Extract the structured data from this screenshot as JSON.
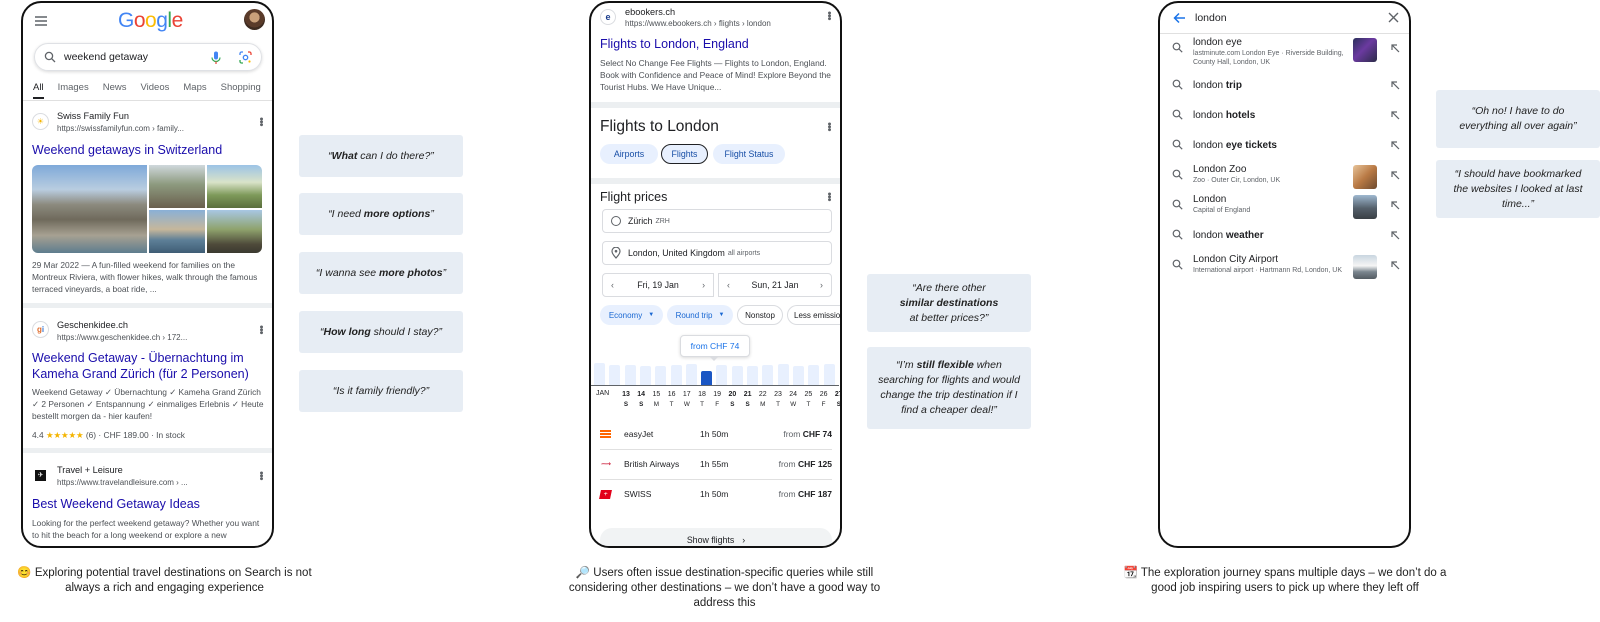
{
  "phone1": {
    "logo": "Google",
    "search_query": "weekend getaway",
    "tabs": [
      "All",
      "Images",
      "News",
      "Videos",
      "Maps",
      "Shopping"
    ],
    "results": [
      {
        "site": "Swiss Family Fun",
        "url": "https://swissfamilyfun.com › family...",
        "title": "Weekend getaways in Switzerland",
        "date": "29 Mar 2022",
        "snippet": "29 Mar 2022 — A fun-filled weekend for families on the Montreux Riviera, with flower hikes, walk through the famous terraced vineyards, a boat ride, ..."
      },
      {
        "site": "Geschenkidee.ch",
        "url": "https://www.geschenkidee.ch › 172...",
        "title": "Weekend Getaway - Übernachtung im Kameha Grand Zürich (für 2 Personen)",
        "snippet": "Weekend Getaway ✓ Übernachtung ✓ Kameha Grand Zürich ✓ 2 Personen ✓ Entspannung ✓ einmaliges Erlebnis ✓ Heute bestellt morgen da - hier kaufen!",
        "rating": "4.4",
        "stars": "★★★★★",
        "rating_tail": "(6) · CHF 189.00 · In stock"
      },
      {
        "site": "Travel + Leisure",
        "url": "https://www.travelandleisure.com › ...",
        "title": "Best Weekend Getaway Ideas",
        "snippet": "Looking for the perfect weekend getaway? Whether you want to hit the beach for a long weekend or explore a new"
      }
    ]
  },
  "quotes1": [
    {
      "pre": "“",
      "bold": "What",
      "post": " can I do there?”"
    },
    {
      "pre": "“I need ",
      "bold": "more options",
      "post": "”"
    },
    {
      "pre": "“I wanna see ",
      "bold": "more photos",
      "post": "”"
    },
    {
      "pre": "“",
      "bold": "How long",
      "post": " should I stay?”"
    },
    {
      "pre": "“Is it family friendly?”",
      "bold": "",
      "post": ""
    }
  ],
  "caption1": "😊 Exploring potential travel destinations on Search is not always a rich and engaging experience",
  "phone2": {
    "site": "ebookers.ch",
    "url": "https://www.ebookers.ch › flights › london",
    "result_title": "Flights to London, England",
    "result_snippet": "Select No Change Fee Flights — Flights to London, England. Book with Confidence and Peace of Mind! Explore Beyond the Tourist Hubs. We Have Unique...",
    "heading": "Flights to London",
    "chips": [
      "Airports",
      "Flights",
      "Flight Status"
    ],
    "prices_heading": "Flight prices",
    "origin": "Zürich",
    "origin_code": "ZRH",
    "destination": "London, United Kingdom",
    "destination_note": "all airports",
    "date_from": "Fri, 19 Jan",
    "date_to": "Sun, 21 Jan",
    "filters": [
      "Economy",
      "Round trip",
      "Nonstop",
      "Less emissio"
    ],
    "tooltip": "from CHF 74",
    "month": "JAN",
    "days": [
      "13",
      "14",
      "15",
      "16",
      "17",
      "18",
      "19",
      "20",
      "21",
      "22",
      "23",
      "24",
      "25",
      "26",
      "27"
    ],
    "weekdays": [
      "S",
      "S",
      "M",
      "T",
      "W",
      "T",
      "F",
      "S",
      "S",
      "M",
      "T",
      "W",
      "T",
      "F",
      "S"
    ],
    "bold_days": [
      "13",
      "14",
      "20",
      "21",
      "27"
    ],
    "airlines": [
      {
        "name": "easyJet",
        "duration": "1h 50m",
        "price_prefix": "from ",
        "price": "CHF 74"
      },
      {
        "name": "British Airways",
        "duration": "1h 55m",
        "price_prefix": "from ",
        "price": "CHF 125"
      },
      {
        "name": "SWISS",
        "duration": "1h 50m",
        "price_prefix": "from ",
        "price": "CHF 187"
      }
    ],
    "show_flights": "Show flights"
  },
  "quotes2": [
    {
      "l1": "“Are there other",
      "bold": "similar destinations",
      "l3": "at better prices?”"
    },
    {
      "pre": "“I’m ",
      "bold": "still flexible",
      "post": " when searching for flights and would change the trip destination if I find a cheaper deal!”"
    }
  ],
  "caption2": "🔎 Users often issue destination-specific queries while still considering other destinations – we don’t have a good way to address this",
  "phone3": {
    "query": "london",
    "suggestions": [
      {
        "plain": "london eye",
        "bold": "",
        "sub": "lastminute.com London Eye · Riverside Building, County Hall, London, UK",
        "thumb": true
      },
      {
        "plain": "london ",
        "bold": "trip",
        "sub": "",
        "thumb": false
      },
      {
        "plain": "london ",
        "bold": "hotels",
        "sub": "",
        "thumb": false
      },
      {
        "plain": "london ",
        "bold": "eye tickets",
        "sub": "",
        "thumb": false
      },
      {
        "plain": "London Zoo",
        "bold": "",
        "sub": "Zoo · Outer Cir, London, UK",
        "thumb": true
      },
      {
        "plain": "London",
        "bold": "",
        "sub": "Capital of England",
        "thumb": true
      },
      {
        "plain": "london ",
        "bold": "weather",
        "sub": "",
        "thumb": false
      },
      {
        "plain": "London City Airport",
        "bold": "",
        "sub": "International airport · Hartmann Rd, London, UK",
        "thumb": true
      }
    ]
  },
  "quotes3": [
    {
      "text": "“Oh no! I have to do everything all over again”"
    },
    {
      "text": "“I should have bookmarked the websites I looked at last time...”"
    }
  ],
  "caption3": "📆 The exploration journey spans multiple days – we don’t do a good job inspiring users to pick up where they left off",
  "colors": {
    "google_blue": "#4285F4",
    "google_red": "#EA4335",
    "google_yellow": "#FBBC05",
    "google_green": "#34A853",
    "link_blue": "#1a0dab",
    "accent_blue": "#1a73e8",
    "quote_bg": "#e7edf4"
  }
}
